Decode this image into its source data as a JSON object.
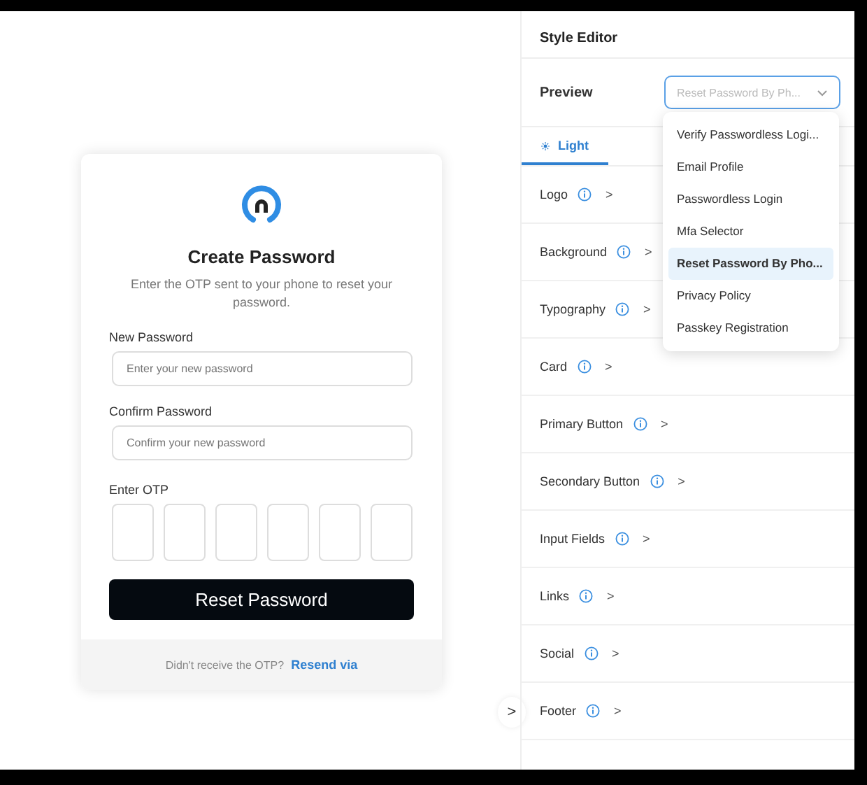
{
  "card": {
    "title": "Create Password",
    "subtitle": "Enter the OTP sent to your phone to reset your password.",
    "fields": [
      {
        "label": "New Password",
        "placeholder": "Enter your new password"
      },
      {
        "label": "Confirm Password",
        "placeholder": "Confirm your new password"
      }
    ],
    "otp": {
      "label": "Enter OTP"
    },
    "submit": "Reset Password",
    "footer": {
      "text": "Didn't receive the OTP?",
      "link": "Resend via"
    }
  },
  "collapse_toggle": ">",
  "editor": {
    "title": "Style Editor",
    "preview_label": "Preview",
    "preview_value": "Reset Password By Ph...",
    "tabs": [
      {
        "label": "Light",
        "selected": true
      }
    ],
    "sections": [
      {
        "label": "Logo"
      },
      {
        "label": "Background"
      },
      {
        "label": "Typography"
      },
      {
        "label": "Card"
      },
      {
        "label": "Primary Button"
      },
      {
        "label": "Secondary Button"
      },
      {
        "label": "Input Fields"
      },
      {
        "label": "Links"
      },
      {
        "label": "Social"
      },
      {
        "label": "Footer"
      }
    ],
    "chevron": ">",
    "dropdown": [
      {
        "label": "Verify Passwordless Logi...",
        "selected": false
      },
      {
        "label": "Email Profile",
        "selected": false
      },
      {
        "label": "Passwordless Login",
        "selected": false
      },
      {
        "label": "Mfa Selector",
        "selected": false
      },
      {
        "label": "Reset Password By Pho...",
        "selected": true
      },
      {
        "label": "Privacy Policy",
        "selected": false
      },
      {
        "label": "Passkey Registration",
        "selected": false
      }
    ]
  }
}
